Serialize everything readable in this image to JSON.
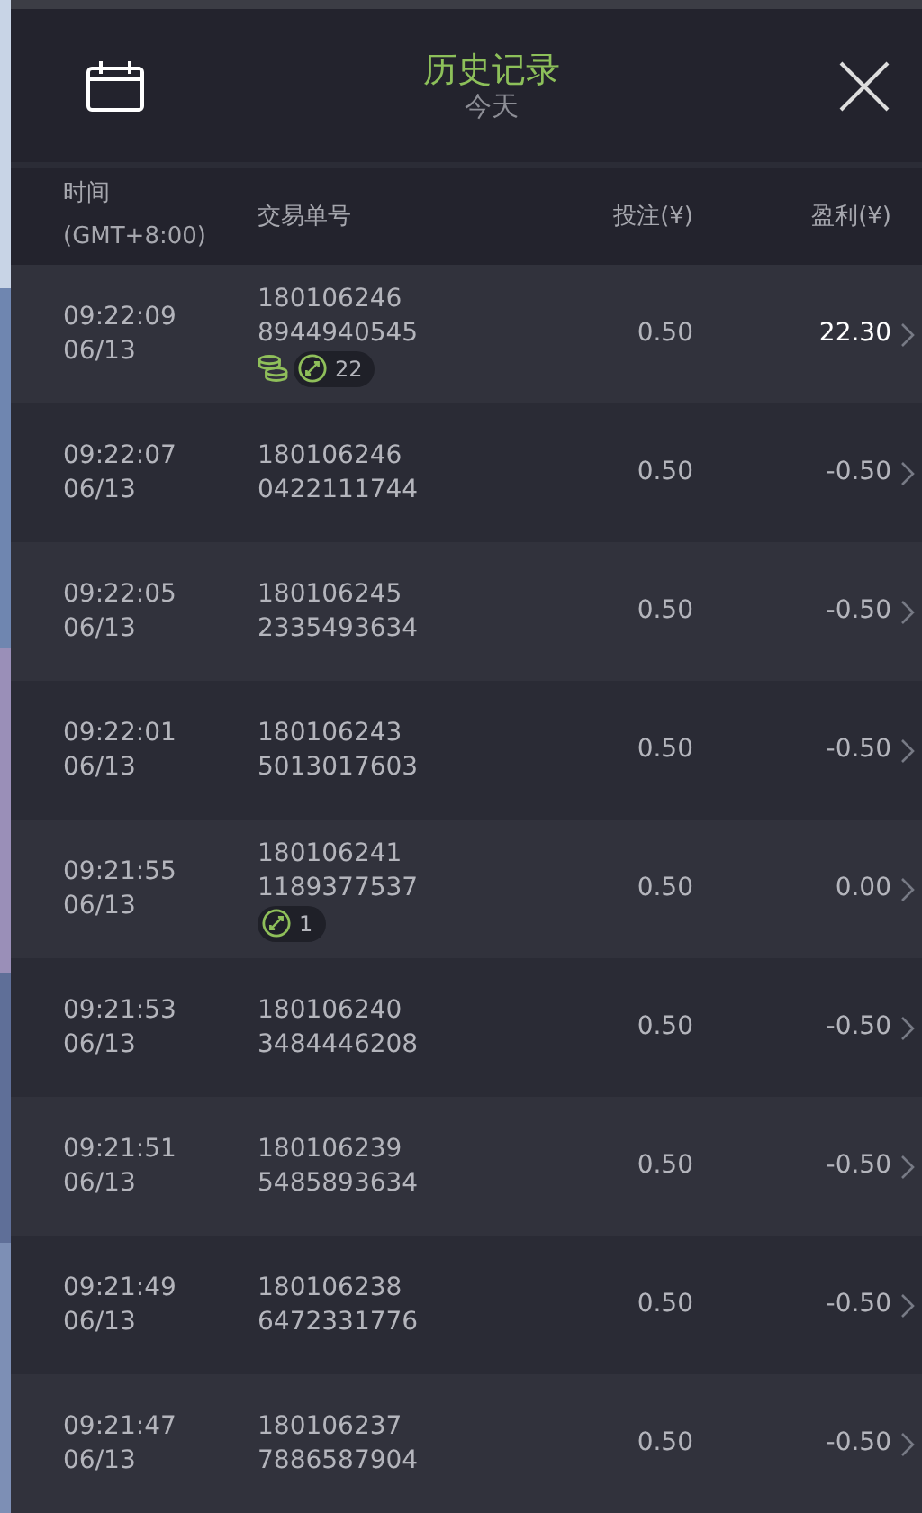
{
  "header": {
    "title": "历史记录",
    "subtitle": "今天"
  },
  "columns": {
    "time": "时间",
    "timezone": "(GMT+8:00)",
    "order": "交易单号",
    "stake": "投注(¥)",
    "profit": "盈利(¥)"
  },
  "rows": [
    {
      "time": "09:22:09",
      "date": "06/13",
      "order_a": "180106246",
      "order_b": "8944940545",
      "stake": "0.50",
      "profit_value": "22.30",
      "won": true,
      "coins": true,
      "count": "22"
    },
    {
      "time": "09:22:07",
      "date": "06/13",
      "order_a": "180106246",
      "order_b": "0422111744",
      "stake": "0.50",
      "profit_value": "-0.50",
      "won": false,
      "coins": false
    },
    {
      "time": "09:22:05",
      "date": "06/13",
      "order_a": "180106245",
      "order_b": "2335493634",
      "stake": "0.50",
      "profit_value": "-0.50",
      "won": false,
      "coins": false
    },
    {
      "time": "09:22:01",
      "date": "06/13",
      "order_a": "180106243",
      "order_b": "5013017603",
      "stake": "0.50",
      "profit_value": "-0.50",
      "won": false,
      "coins": false
    },
    {
      "time": "09:21:55",
      "date": "06/13",
      "order_a": "180106241",
      "order_b": "1189377537",
      "stake": "0.50",
      "profit_value": "0.00",
      "won": false,
      "coins": false,
      "count": "1"
    },
    {
      "time": "09:21:53",
      "date": "06/13",
      "order_a": "180106240",
      "order_b": "3484446208",
      "stake": "0.50",
      "profit_value": "-0.50",
      "won": false,
      "coins": false
    },
    {
      "time": "09:21:51",
      "date": "06/13",
      "order_a": "180106239",
      "order_b": "5485893634",
      "stake": "0.50",
      "profit_value": "-0.50",
      "won": false,
      "coins": false
    },
    {
      "time": "09:21:49",
      "date": "06/13",
      "order_a": "180106238",
      "order_b": "6472331776",
      "stake": "0.50",
      "profit_value": "-0.50",
      "won": false,
      "coins": false
    },
    {
      "time": "09:21:47",
      "date": "06/13",
      "order_a": "180106237",
      "order_b": "7886587904",
      "stake": "0.50",
      "profit_value": "-0.50",
      "won": false,
      "coins": false
    }
  ]
}
